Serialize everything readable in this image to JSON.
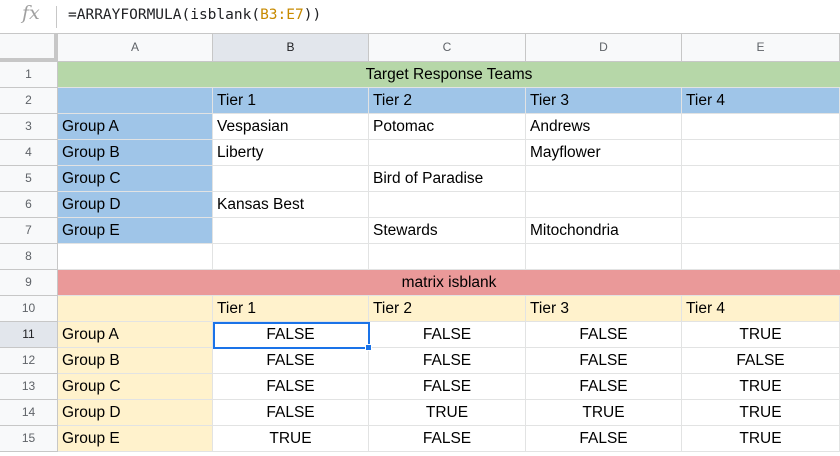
{
  "formula_bar": {
    "fx_icon": "fx",
    "prefix": "=ARRAYFORMULA(isblank(",
    "range": "B3:E7",
    "suffix": "))"
  },
  "columns": [
    "A",
    "B",
    "C",
    "D",
    "E"
  ],
  "rows": [
    "1",
    "2",
    "3",
    "4",
    "5",
    "6",
    "7",
    "8",
    "9",
    "10",
    "11",
    "12",
    "13",
    "14",
    "15"
  ],
  "selected_column": "B",
  "selected_row": "11",
  "header_color_blue": "#9fc5e8",
  "header_color_green": "#b6d7a8",
  "header_color_red": "#ea9999",
  "header_color_yellow": "#fff2cc",
  "table1": {
    "title": "Target Response Teams",
    "tiers": [
      "Tier 1",
      "Tier 2",
      "Tier 3",
      "Tier 4"
    ],
    "groups": [
      "Group A",
      "Group B",
      "Group C",
      "Group D",
      "Group E"
    ],
    "cells": [
      [
        "Vespasian",
        "Potomac",
        "Andrews",
        ""
      ],
      [
        "Liberty",
        "",
        "Mayflower",
        ""
      ],
      [
        "",
        "Bird of Paradise",
        "",
        ""
      ],
      [
        "Kansas Best",
        "",
        "",
        ""
      ],
      [
        "",
        "Stewards",
        "Mitochondria",
        ""
      ]
    ]
  },
  "table2": {
    "title": "matrix isblank",
    "tiers": [
      "Tier 1",
      "Tier 2",
      "Tier 3",
      "Tier 4"
    ],
    "groups": [
      "Group A",
      "Group B",
      "Group C",
      "Group D",
      "Group E"
    ],
    "cells": [
      [
        "FALSE",
        "FALSE",
        "FALSE",
        "TRUE"
      ],
      [
        "FALSE",
        "FALSE",
        "FALSE",
        "FALSE"
      ],
      [
        "FALSE",
        "FALSE",
        "FALSE",
        "TRUE"
      ],
      [
        "FALSE",
        "TRUE",
        "TRUE",
        "TRUE"
      ],
      [
        "TRUE",
        "FALSE",
        "FALSE",
        "TRUE"
      ]
    ]
  }
}
